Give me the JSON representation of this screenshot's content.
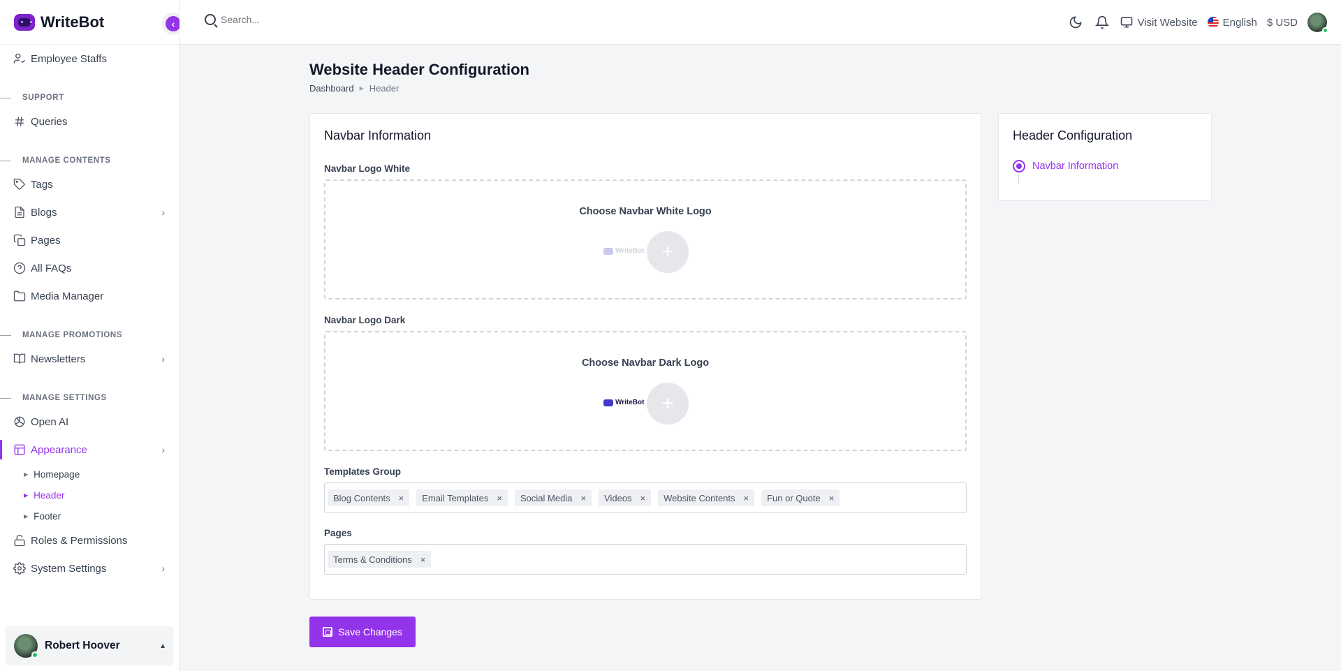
{
  "brand": {
    "name": "WriteBot"
  },
  "sidebar": {
    "items": [
      {
        "type": "item",
        "label": "Employee Staffs",
        "icon": "user-check-icon"
      },
      {
        "type": "section",
        "label": "SUPPORT"
      },
      {
        "type": "item",
        "label": "Queries",
        "icon": "hash-icon"
      },
      {
        "type": "section",
        "label": "MANAGE CONTENTS"
      },
      {
        "type": "item",
        "label": "Tags",
        "icon": "tag-icon"
      },
      {
        "type": "item",
        "label": "Blogs",
        "icon": "file-text-icon",
        "expandable": true
      },
      {
        "type": "item",
        "label": "Pages",
        "icon": "copy-icon"
      },
      {
        "type": "item",
        "label": "All FAQs",
        "icon": "help-circle-icon"
      },
      {
        "type": "item",
        "label": "Media Manager",
        "icon": "folder-icon"
      },
      {
        "type": "section",
        "label": "MANAGE PROMOTIONS"
      },
      {
        "type": "item",
        "label": "Newsletters",
        "icon": "book-open-icon",
        "expandable": true
      },
      {
        "type": "section",
        "label": "MANAGE SETTINGS"
      },
      {
        "type": "item",
        "label": "Open AI",
        "icon": "openai-icon"
      },
      {
        "type": "item",
        "label": "Appearance",
        "icon": "layout-icon",
        "expandable": true,
        "active": true
      },
      {
        "type": "sub",
        "label": "Homepage"
      },
      {
        "type": "sub",
        "label": "Header",
        "active": true
      },
      {
        "type": "sub",
        "label": "Footer"
      },
      {
        "type": "item",
        "label": "Roles & Permissions",
        "icon": "unlock-icon"
      },
      {
        "type": "item",
        "label": "System Settings",
        "icon": "settings-icon",
        "expandable": true
      }
    ],
    "user": {
      "name": "Robert Hoover"
    }
  },
  "topbar": {
    "search_placeholder": "Search...",
    "visit_website": "Visit Website",
    "language": "English",
    "currency": "$ USD"
  },
  "page": {
    "title": "Website Header Configuration",
    "breadcrumb": [
      "Dashboard",
      "Header"
    ]
  },
  "form": {
    "card_title": "Navbar Information",
    "logo_white": {
      "label": "Navbar Logo White",
      "title": "Choose Navbar White Logo",
      "preview_text": "WriteBot"
    },
    "logo_dark": {
      "label": "Navbar Logo Dark",
      "title": "Choose Navbar Dark Logo",
      "preview_text": "WriteBot"
    },
    "templates_group": {
      "label": "Templates Group",
      "tags": [
        "Blog Contents",
        "Email Templates",
        "Social Media",
        "Videos",
        "Website Contents",
        "Fun or Quote"
      ]
    },
    "pages": {
      "label": "Pages",
      "tags": [
        "Terms & Conditions"
      ]
    },
    "save_label": "Save Changes"
  },
  "config_panel": {
    "title": "Header Configuration",
    "steps": [
      "Navbar Information"
    ]
  },
  "colors": {
    "accent": "#9333ea",
    "online": "#22c55e"
  }
}
